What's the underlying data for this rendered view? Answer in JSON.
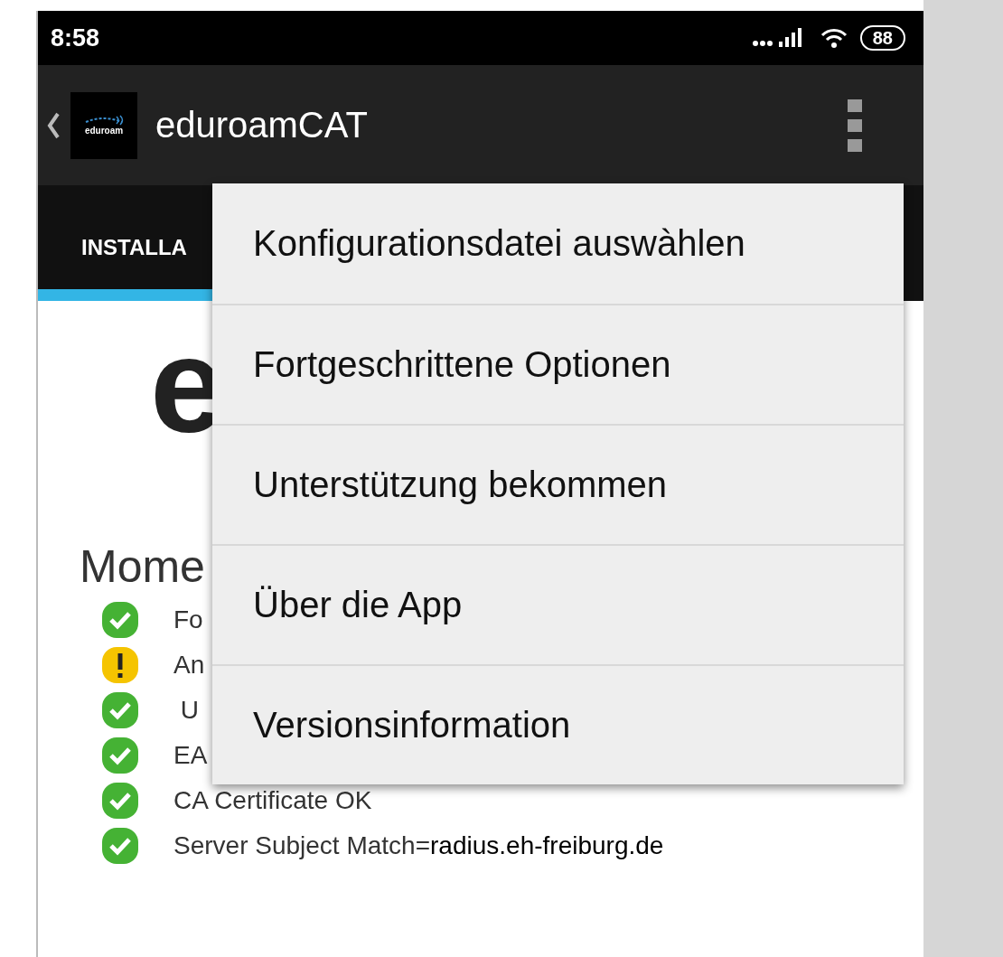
{
  "status_bar": {
    "time": "8:58",
    "battery": "88"
  },
  "app_bar": {
    "logo_label": "eduroam",
    "title": "eduroamCAT"
  },
  "tabs": [
    {
      "label": "INSTALLA",
      "selected": true
    }
  ],
  "content": {
    "logo_text": "e",
    "heading": "Mome",
    "checks": [
      {
        "kind": "ok",
        "text": "Fo"
      },
      {
        "kind": "warning",
        "text": "An"
      },
      {
        "kind": "ok",
        "text": " U"
      },
      {
        "kind": "ok",
        "text": "EA"
      },
      {
        "kind": "ok",
        "text": "CA Certificate OK"
      },
      {
        "kind": "ok",
        "text": "Server Subject Match=",
        "value": "radius.eh-freiburg.de"
      }
    ]
  },
  "menu": {
    "items": [
      "Konfigurationsdatei auswàhlen",
      "Fortgeschrittene Optionen",
      "Unterstützung bekommen",
      "Über die App",
      "Versionsinformation"
    ]
  }
}
